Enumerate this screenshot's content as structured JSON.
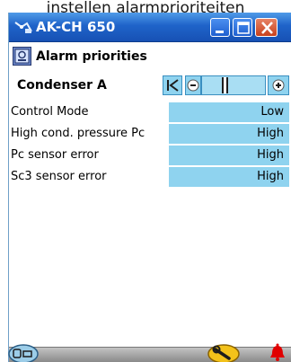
{
  "caption": "instellen alarmprioriteiten",
  "window": {
    "title": "AK-CH 650",
    "icons": {
      "app": "meter-icon",
      "minimize": "minimize-icon",
      "maximize": "maximize-icon",
      "close": "close-icon"
    }
  },
  "page": {
    "title": "Alarm priorities",
    "icon": "alarm-list-icon"
  },
  "device": {
    "name": "Condenser A",
    "nav": {
      "first": "first-icon",
      "prev": "previous-icon",
      "next": "next-icon",
      "position_fraction": 0.35
    }
  },
  "params": [
    {
      "label": "Control Mode",
      "value": "Low"
    },
    {
      "label": "High cond. pressure Pc",
      "value": "High"
    },
    {
      "label": "Pc sensor error",
      "value": "High"
    },
    {
      "label": "Sc3 sensor error",
      "value": "High"
    }
  ],
  "bottombar": {
    "icons": {
      "left": "controller-icon",
      "middle": "wrench-icon",
      "right": "alarm-bell-icon"
    }
  },
  "colors": {
    "titlebar": "#1f63c9",
    "value_cell": "#8fd3ef",
    "close_button": "#c8401c",
    "bell": "#e00000"
  }
}
